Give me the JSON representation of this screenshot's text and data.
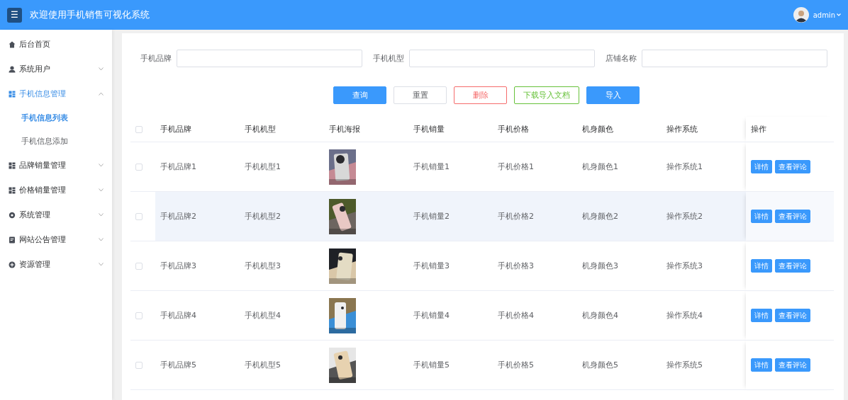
{
  "header": {
    "menu_toggle": "☰",
    "title": "欢迎使用手机销售可视化系统",
    "user": "admin"
  },
  "sidebar": {
    "items": [
      {
        "label": "后台首页",
        "selected": false
      },
      {
        "label": "系统用户",
        "selected": false,
        "expanded": false
      },
      {
        "label": "手机信息管理",
        "selected": true,
        "expanded": true,
        "children": [
          {
            "label": "手机信息列表",
            "selected": true
          },
          {
            "label": "手机信息添加",
            "selected": false
          }
        ]
      },
      {
        "label": "品牌销量管理",
        "selected": false,
        "expanded": false
      },
      {
        "label": "价格销量管理",
        "selected": false,
        "expanded": false
      },
      {
        "label": "系统管理",
        "selected": false,
        "expanded": false
      },
      {
        "label": "网站公告管理",
        "selected": false,
        "expanded": false
      },
      {
        "label": "资源管理",
        "selected": false,
        "expanded": false
      }
    ]
  },
  "search": {
    "fields": [
      {
        "label": "手机品牌"
      },
      {
        "label": "手机机型"
      },
      {
        "label": "店铺名称"
      }
    ],
    "buttons": [
      {
        "label": "查询",
        "kind": "primary"
      },
      {
        "label": "重置",
        "kind": "plain"
      },
      {
        "label": "删除",
        "kind": "danger"
      },
      {
        "label": "下载导入文档",
        "kind": "success"
      },
      {
        "label": "导入",
        "kind": "primary"
      }
    ]
  },
  "table": {
    "select_all_checked": false,
    "columns": [
      "手机品牌",
      "手机机型",
      "手机海报",
      "手机销量",
      "手机价格",
      "机身颜色",
      "操作系统",
      "操作"
    ],
    "rows": [
      {
        "checked": false,
        "hovered": false,
        "cells": [
          {
            "kind": "text",
            "text": "手机品牌1"
          },
          {
            "kind": "text",
            "text": "手机机型1"
          },
          {
            "kind": "picture"
          },
          {
            "kind": "text",
            "text": "手机销量1"
          },
          {
            "kind": "text",
            "text": "手机价格1"
          },
          {
            "kind": "text",
            "text": "机身颜色1"
          },
          {
            "kind": "text",
            "text": "操作系统1"
          }
        ],
        "actions": [
          "详情",
          "查看评论"
        ]
      },
      {
        "checked": false,
        "hovered": true,
        "cells": [
          {
            "kind": "text",
            "text": "手机品牌2"
          },
          {
            "kind": "text",
            "text": "手机机型2"
          },
          {
            "kind": "picture"
          },
          {
            "kind": "text",
            "text": "手机销量2"
          },
          {
            "kind": "text",
            "text": "手机价格2"
          },
          {
            "kind": "text",
            "text": "机身颜色2"
          },
          {
            "kind": "text",
            "text": "操作系统2"
          }
        ],
        "actions": [
          "详情",
          "查看评论"
        ]
      },
      {
        "checked": false,
        "hovered": false,
        "cells": [
          {
            "kind": "text",
            "text": "手机品牌3"
          },
          {
            "kind": "text",
            "text": "手机机型3"
          },
          {
            "kind": "picture"
          },
          {
            "kind": "text",
            "text": "手机销量3"
          },
          {
            "kind": "text",
            "text": "手机价格3"
          },
          {
            "kind": "text",
            "text": "机身颜色3"
          },
          {
            "kind": "text",
            "text": "操作系统3"
          }
        ],
        "actions": [
          "详情",
          "查看评论"
        ]
      },
      {
        "checked": false,
        "hovered": false,
        "cells": [
          {
            "kind": "text",
            "text": "手机品牌4"
          },
          {
            "kind": "text",
            "text": "手机机型4"
          },
          {
            "kind": "picture"
          },
          {
            "kind": "text",
            "text": "手机销量4"
          },
          {
            "kind": "text",
            "text": "手机价格4"
          },
          {
            "kind": "text",
            "text": "机身颜色4"
          },
          {
            "kind": "text",
            "text": "操作系统4"
          }
        ],
        "actions": [
          "详情",
          "查看评论"
        ]
      },
      {
        "checked": false,
        "hovered": false,
        "cells": [
          {
            "kind": "text",
            "text": "手机品牌5"
          },
          {
            "kind": "text",
            "text": "手机机型5"
          },
          {
            "kind": "picture"
          },
          {
            "kind": "text",
            "text": "手机销量5"
          },
          {
            "kind": "text",
            "text": "手机价格5"
          },
          {
            "kind": "text",
            "text": "机身颜色5"
          },
          {
            "kind": "text",
            "text": "操作系统5"
          }
        ],
        "actions": [
          "详情",
          "查看评论"
        ]
      }
    ]
  }
}
